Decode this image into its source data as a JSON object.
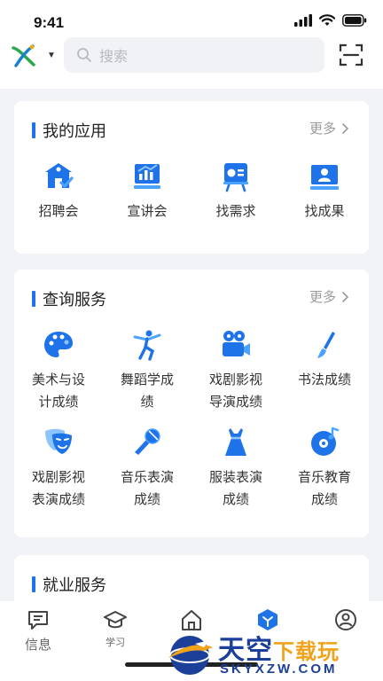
{
  "status": {
    "time": "9:41"
  },
  "search": {
    "placeholder": "搜索"
  },
  "my_apps": {
    "title": "我的应用",
    "more": "更多",
    "items": [
      {
        "label": "招聘会",
        "icon": "building-icon"
      },
      {
        "label": "宣讲会",
        "icon": "presentation-chart-icon"
      },
      {
        "label": "找需求",
        "icon": "easel-board-icon"
      },
      {
        "label": "找成果",
        "icon": "monitor-person-icon"
      }
    ]
  },
  "query": {
    "title": "查询服务",
    "more": "更多",
    "items": [
      {
        "label": "美术与设\n计成绩",
        "icon": "palette-icon"
      },
      {
        "label": "舞蹈学成\n绩",
        "icon": "dancer-icon"
      },
      {
        "label": "戏剧影视\n导演成绩",
        "icon": "film-camera-icon"
      },
      {
        "label": "书法成绩",
        "icon": "brush-icon"
      },
      {
        "label": "戏剧影视\n表演成绩",
        "icon": "theater-mask-icon"
      },
      {
        "label": "音乐表演\n成绩",
        "icon": "microphone-icon"
      },
      {
        "label": "服装表演\n成绩",
        "icon": "dress-icon"
      },
      {
        "label": "音乐教育\n成绩",
        "icon": "music-disc-icon"
      }
    ]
  },
  "employment": {
    "title": "就业服务"
  },
  "bottom_nav": {
    "items": [
      {
        "label": "信息",
        "icon": "chat-icon"
      },
      {
        "label": "学习",
        "icon": "graduation-cap-icon"
      },
      {
        "label": "",
        "icon": "home-icon"
      },
      {
        "label": "",
        "icon": "cube-icon",
        "active": true
      },
      {
        "label": "",
        "icon": "user-icon"
      }
    ]
  },
  "watermark": {
    "title": "天空",
    "title_accent": "下载玩",
    "sub": "SKYXZW.COM"
  },
  "colors": {
    "accent": "#1f73e8",
    "accent_light": "#4aa3ff",
    "background": "#f2f3f6"
  }
}
